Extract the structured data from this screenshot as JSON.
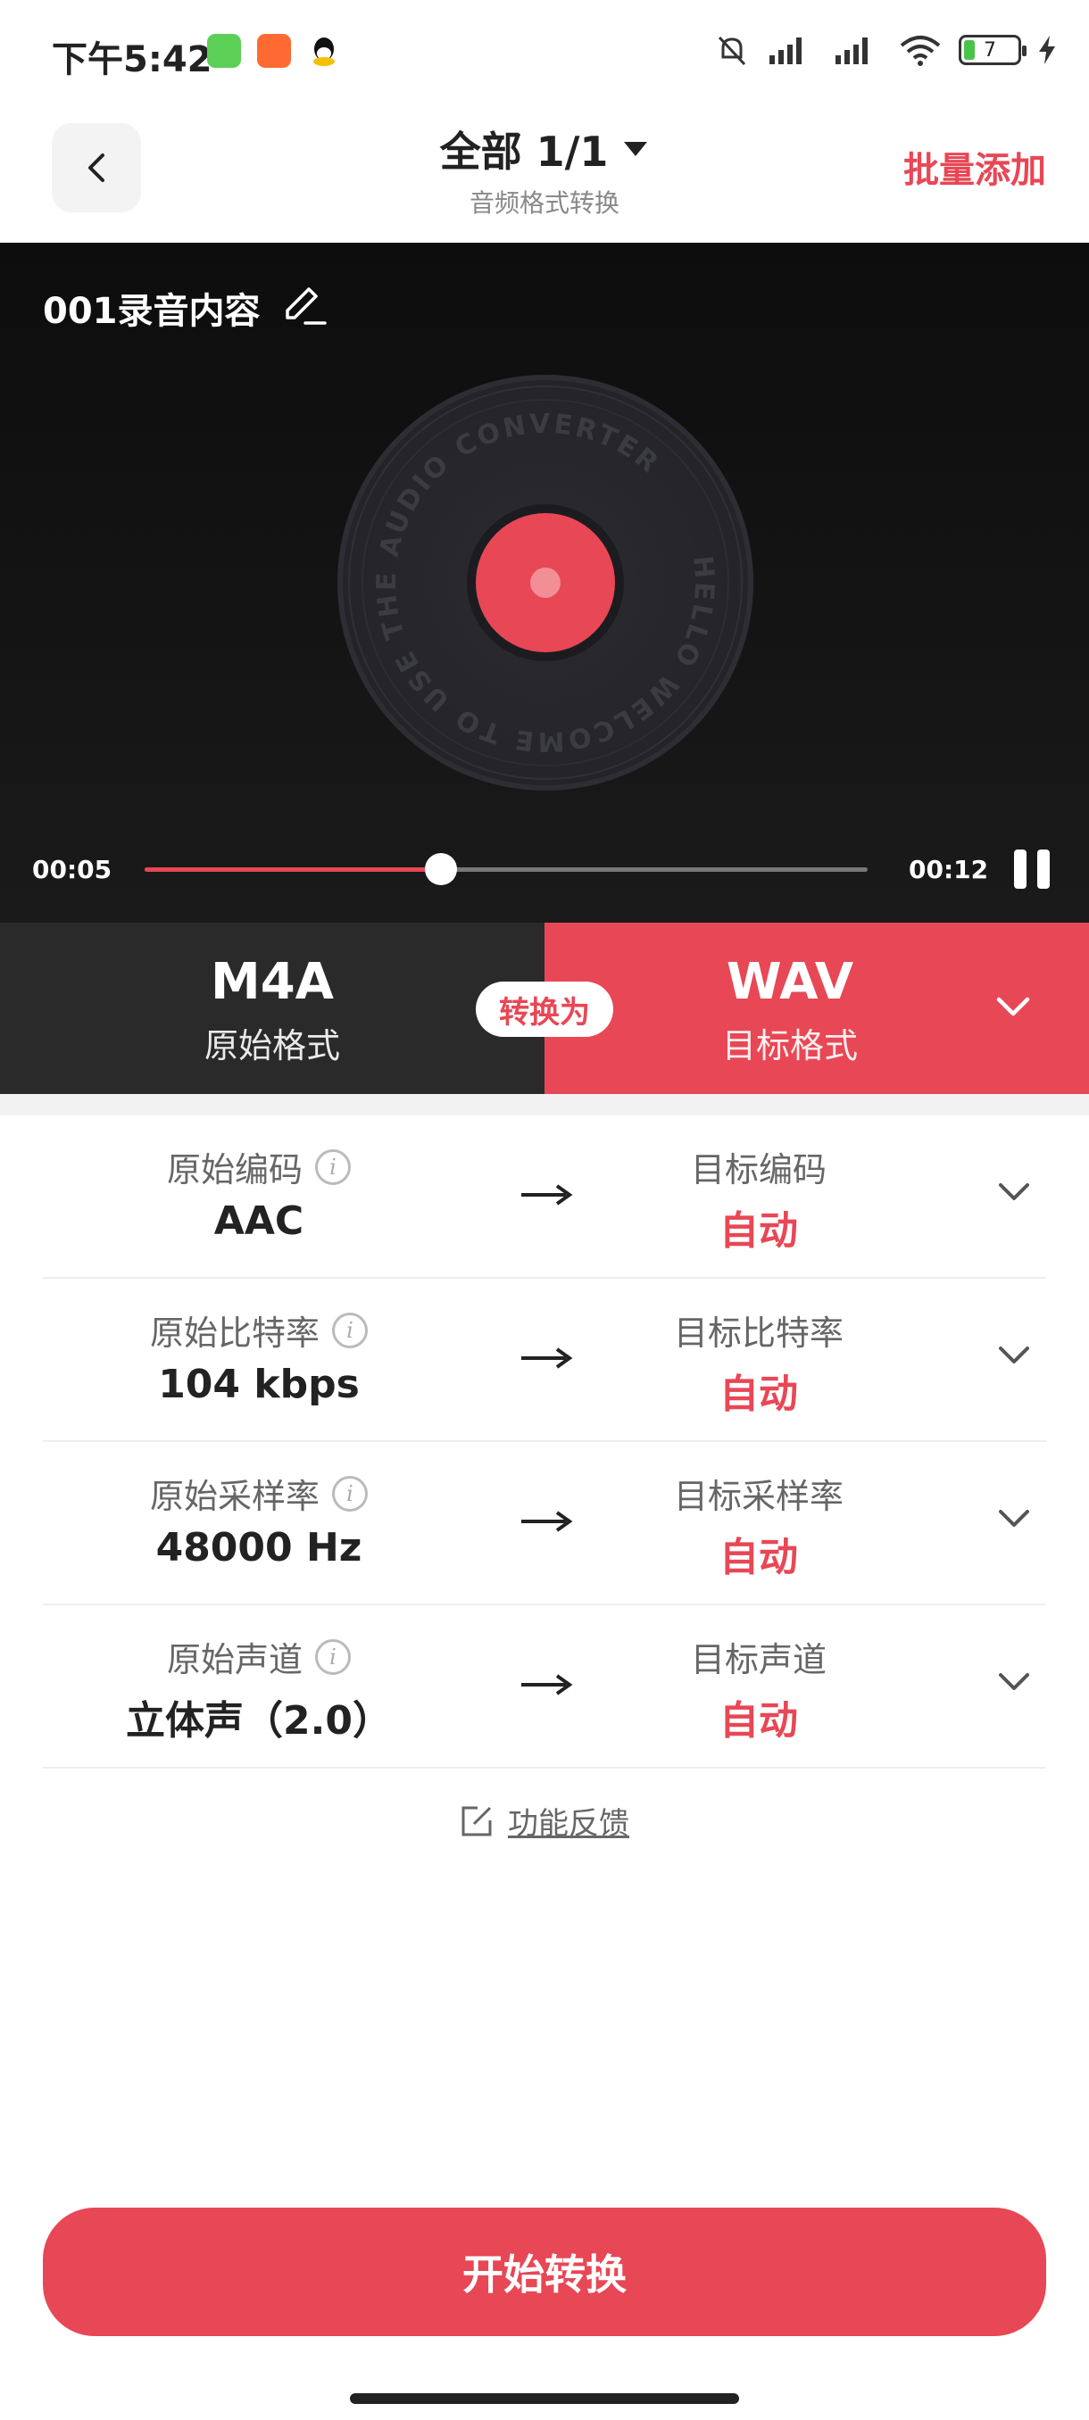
{
  "status": {
    "time": "下午5:42",
    "battery": "7"
  },
  "header": {
    "title": "全部 1/1",
    "subtitle": "音频格式转换",
    "batch_add": "批量添加"
  },
  "player": {
    "file_name": "001录音内容",
    "disc_text": "HELLO WELCOME TO USE THE AUDIO CONVERTER",
    "current_time": "00:05",
    "total_time": "00:12",
    "progress": 0.41
  },
  "formats": {
    "source_name": "M4A",
    "source_label": "原始格式",
    "convert_label": "转换为",
    "target_name": "WAV",
    "target_label": "目标格式"
  },
  "params": [
    {
      "orig_label": "原始编码",
      "orig_value": "AAC",
      "target_label": "目标编码",
      "target_value": "自动"
    },
    {
      "orig_label": "原始比特率",
      "orig_value": "104 kbps",
      "target_label": "目标比特率",
      "target_value": "自动"
    },
    {
      "orig_label": "原始采样率",
      "orig_value": "48000 Hz",
      "target_label": "目标采样率",
      "target_value": "自动"
    },
    {
      "orig_label": "原始声道",
      "orig_value": "立体声（2.0）",
      "target_label": "目标声道",
      "target_value": "自动"
    }
  ],
  "feedback": "功能反馈",
  "start_button": "开始转换",
  "colors": {
    "accent": "#e84755",
    "dark": "#2a2a2a"
  }
}
